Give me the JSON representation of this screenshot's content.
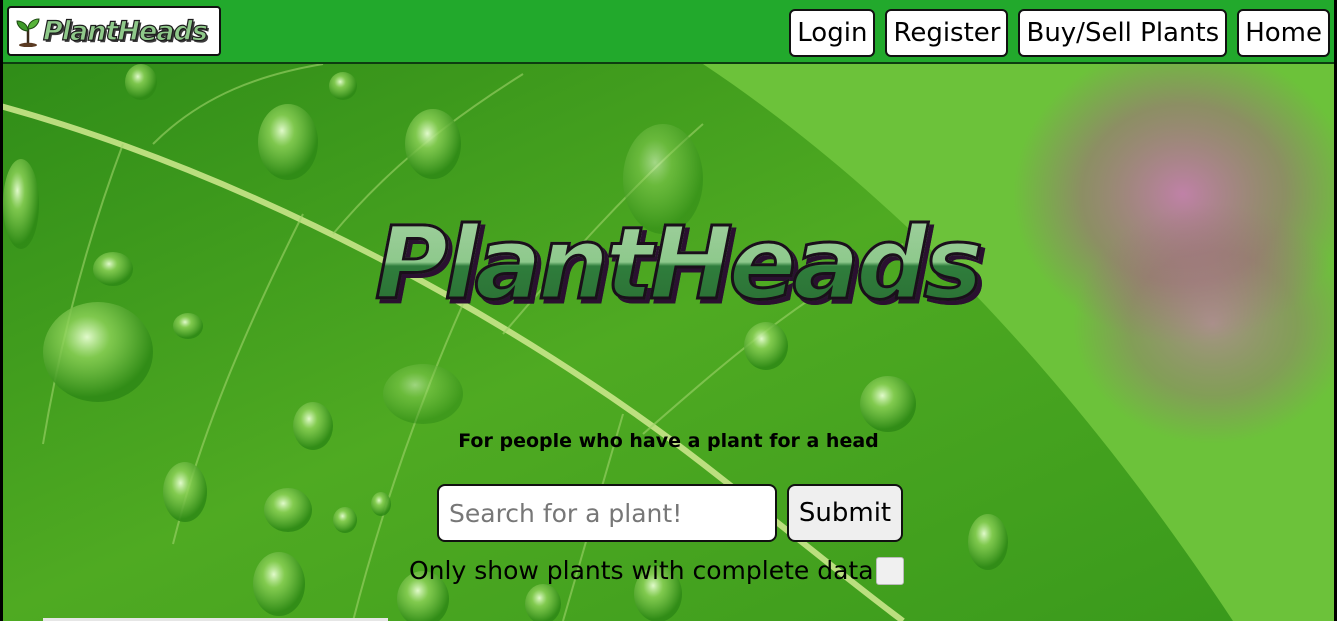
{
  "navbar": {
    "logo_text": "PlantHeads",
    "links": [
      "Login",
      "Register",
      "Buy/Sell Plants",
      "Home"
    ]
  },
  "hero": {
    "title": "PlantHeads",
    "tagline": "For people who have a plant for a head"
  },
  "search": {
    "placeholder": "Search for a plant!",
    "value": "",
    "submit_label": "Submit"
  },
  "filter": {
    "label": "Only show plants with complete data",
    "checked": false
  },
  "colors": {
    "navbar": "#22a92c",
    "logo_light": "#8ec98c",
    "logo_dark": "#2b6f33"
  },
  "icons": {
    "logo": "sprout-icon"
  }
}
